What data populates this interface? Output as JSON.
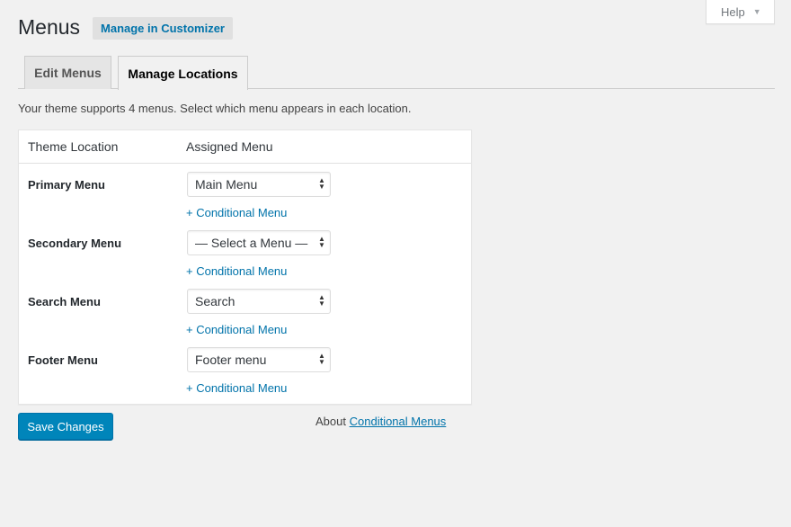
{
  "help": {
    "label": "Help",
    "arrow": "▼"
  },
  "header": {
    "title": "Menus",
    "action_label": "Manage in Customizer"
  },
  "tabs": [
    {
      "label": "Edit Menus",
      "active": false
    },
    {
      "label": "Manage Locations",
      "active": true
    }
  ],
  "intro": "Your theme supports 4 menus. Select which menu appears in each location.",
  "table": {
    "columns": [
      "Theme Location",
      "Assigned Menu"
    ],
    "rows": [
      {
        "location": "Primary Menu",
        "selected": "Main Menu",
        "link": "+ Conditional Menu"
      },
      {
        "location": "Secondary Menu",
        "selected": "— Select a Menu —",
        "link": "+ Conditional Menu"
      },
      {
        "location": "Search Menu",
        "selected": "Search",
        "link": "+ Conditional Menu"
      },
      {
        "location": "Footer Menu",
        "selected": "Footer menu",
        "link": "+ Conditional Menu"
      }
    ]
  },
  "footer": {
    "save_label": "Save Changes",
    "about_prefix": "About",
    "about_link": "Conditional Menus"
  },
  "icons": {
    "select_caret": "select-caret-icon",
    "help_arrow": "triangle-down-icon"
  },
  "colors": {
    "accent": "#0073aa",
    "button": "#0085ba",
    "background": "#f1f1f1"
  }
}
